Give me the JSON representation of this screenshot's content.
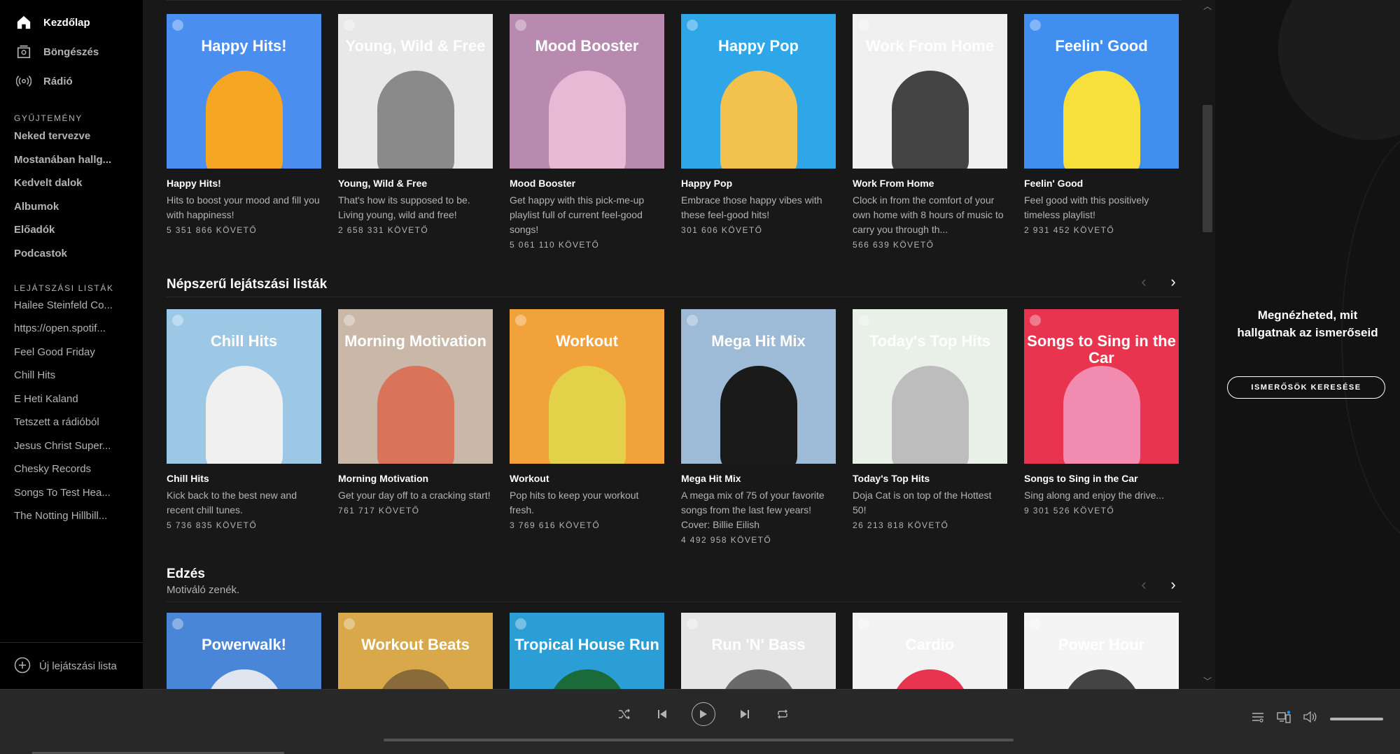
{
  "sidebar": {
    "nav": [
      {
        "label": "Kezdőlap",
        "icon": "home-icon",
        "active": true
      },
      {
        "label": "Böngészés",
        "icon": "browse-icon",
        "active": false
      },
      {
        "label": "Rádió",
        "icon": "radio-icon",
        "active": false
      }
    ],
    "collection_label": "GYŰJTEMÉNY",
    "collection": [
      "Neked tervezve",
      "Mostanában hallg...",
      "Kedvelt dalok",
      "Albumok",
      "Előadók",
      "Podcastok"
    ],
    "playlists_label": "LEJÁTSZÁSI LISTÁK",
    "playlists": [
      "Hailee Steinfeld Co...",
      "https://open.spotif...",
      "Feel Good Friday",
      "Chill Hits",
      "E Heti Kaland",
      "Tetszett a rádióból",
      "Jesus Christ Super...",
      "Chesky Records",
      "Songs To Test Hea...",
      "The Notting Hillbill..."
    ],
    "new_playlist": "Új lejátszási lista"
  },
  "rows": [
    {
      "title": "",
      "cards": [
        {
          "cover_title": "Happy Hits!",
          "name": "Happy Hits!",
          "desc": "Hits to boost your mood and fill you with happiness!",
          "followers": "5 351 866 KÖVETŐ",
          "bg": "#4a8ff0",
          "fig": "#f5a623"
        },
        {
          "cover_title": "Young, Wild & Free",
          "name": "Young, Wild & Free",
          "desc": "That's how its supposed to be. Living young, wild and free!",
          "followers": "2 658 331 KÖVETŐ",
          "bg": "#e8e8e8",
          "fig": "#8a8a8a"
        },
        {
          "cover_title": "Mood Booster",
          "name": "Mood Booster",
          "desc": "Get happy with this pick-me-up playlist full of current feel-good songs!",
          "followers": "5 061 110 KÖVETŐ",
          "bg": "#b88ab0",
          "fig": "#e7b9d4"
        },
        {
          "cover_title": "Happy Pop",
          "name": "Happy Pop",
          "desc": "Embrace those happy vibes with these feel-good hits!",
          "followers": "301 606 KÖVETŐ",
          "bg": "#2ea6e8",
          "fig": "#f2c14e"
        },
        {
          "cover_title": "Work From Home",
          "name": "Work From Home",
          "desc": "Clock in from the comfort of your own home with 8 hours of music to carry you through th...",
          "followers": "566 639 KÖVETŐ",
          "bg": "#f0f0f0",
          "fig": "#444444"
        },
        {
          "cover_title": "Feelin' Good",
          "name": "Feelin' Good",
          "desc": "Feel good with this positively timeless playlist!",
          "followers": "2 931 452 KÖVETŐ",
          "bg": "#3f8ef0",
          "fig": "#f7e03c"
        }
      ]
    },
    {
      "title": "Népszerű lejátszási listák",
      "cards": [
        {
          "cover_title": "Chill Hits",
          "name": "Chill Hits",
          "desc": "Kick back to the best new and recent chill tunes.",
          "followers": "5 736 835 KÖVETŐ",
          "bg": "#9cc8e6",
          "fig": "#f0f0f0"
        },
        {
          "cover_title": "Morning Motivation",
          "name": "Morning Motivation",
          "desc": "Get your day off to a cracking start!",
          "followers": "761 717 KÖVETŐ",
          "bg": "#c9b8a8",
          "fig": "#d9735a"
        },
        {
          "cover_title": "Workout",
          "name": "Workout",
          "desc": "Pop hits to keep your workout fresh.",
          "followers": "3 769 616 KÖVETŐ",
          "bg": "#f2a23a",
          "fig": "#e3d14a"
        },
        {
          "cover_title": "Mega Hit Mix",
          "name": "Mega Hit Mix",
          "desc": "A mega mix of 75 of your favorite songs from the last few years! Cover: Billie Eilish",
          "followers": "4 492 958 KÖVETŐ",
          "bg": "#9dbbd6",
          "fig": "#1a1a1a"
        },
        {
          "cover_title": "Today's Top Hits",
          "name": "Today's Top Hits",
          "desc": "Doja Cat is on top of the Hottest 50!",
          "followers": "26 213 818 KÖVETŐ",
          "bg": "#e8f0e8",
          "fig": "#bdbdbd"
        },
        {
          "cover_title": "Songs to Sing in the Car",
          "name": "Songs to Sing in the Car",
          "desc": "Sing along and enjoy the drive...",
          "followers": "9 301 526 KÖVETŐ",
          "bg": "#e8344e",
          "fig": "#f28bb0"
        }
      ]
    },
    {
      "title": "Edzés",
      "subtitle": "Motiváló zenék.",
      "cards": [
        {
          "cover_title": "Powerwalk!",
          "bg": "#4a86d8",
          "fig": "#dfe6ef"
        },
        {
          "cover_title": "Workout Beats",
          "bg": "#d9a84a",
          "fig": "#8a6a3a"
        },
        {
          "cover_title": "Tropical House Run",
          "bg": "#2b9ed6",
          "fig": "#1a6a3a"
        },
        {
          "cover_title": "Run 'N' Bass",
          "bg": "#e6e6e6",
          "fig": "#6a6a6a"
        },
        {
          "cover_title": "Cardio",
          "bg": "#f2f2f2",
          "fig": "#e8344e"
        },
        {
          "cover_title": "Power Hour",
          "bg": "#f4f4f4",
          "fig": "#444444"
        }
      ]
    }
  ],
  "friends": {
    "message": "Megnézheted, mit hallgatnak az ismerőseid",
    "button": "ISMERŐSÖK KERESÉSE"
  },
  "player": {
    "progress": 0,
    "volume": 1
  }
}
